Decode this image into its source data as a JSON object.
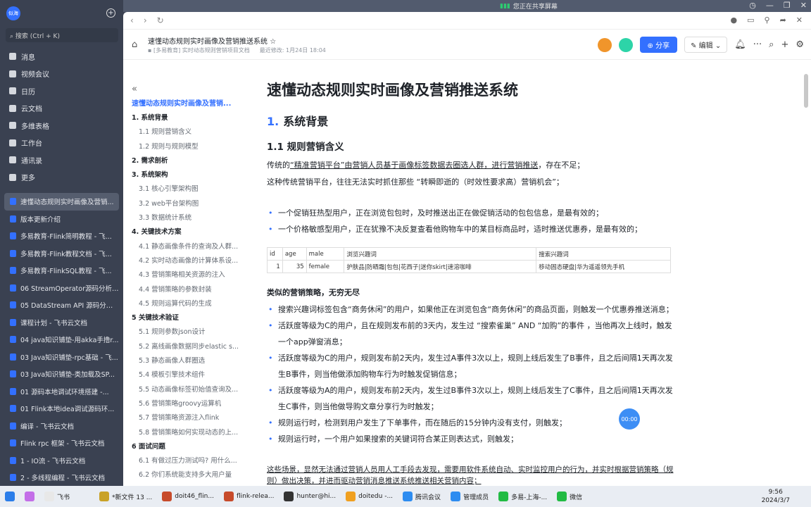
{
  "topbar": {
    "sharing_text": "您正在共享屏幕"
  },
  "sidebar": {
    "avatar": "似海",
    "search_placeholder": "搜索 (Ctrl + K)",
    "nav": [
      "消息",
      "视频会议",
      "日历",
      "云文档",
      "多维表格",
      "工作台",
      "通讯录",
      "更多"
    ],
    "docs": [
      "速懂动态规则实时画像及营销...",
      "版本更新介绍",
      "多易教育-Flink简明教程 - 飞...",
      "多易教育-Flink教程文档 - 飞...",
      "多易教育-FlinkSQL教程 - 飞...",
      "06 StreamOperator源码分析 -...",
      "05 DataStream API 源码分析...",
      "课程计划 - 飞书云文档",
      "04 java知识铺垫-用akka手撸r...",
      "03 Java知识铺垫-rpc基础 - 飞...",
      "03 Java知识铺垫-类加载及SP...",
      "01 源码本地调试环境搭建 -...",
      "01 Flink本地idea调试源码环...",
      "编译 - 飞书云文档",
      "Flink rpc 框架 - 飞书云文档",
      "1 - IO流 - 飞书云文档",
      "2 - 多线程编程 - 飞书云文档"
    ]
  },
  "header": {
    "title": "速懂动态规则实时画像及营销推送系统",
    "folder": "[多易教育] 实时动态规则营销项目文档",
    "modified": "最近修改: 1月24日 18:04",
    "share": "分享",
    "edit": "编辑"
  },
  "toc": {
    "title": "速懂动态规则实时画像及营销...",
    "items": [
      {
        "l": 1,
        "t": "1. 系统背景"
      },
      {
        "l": 2,
        "t": "1.1 规则营销含义"
      },
      {
        "l": 2,
        "t": "1.2 规则与规则模型"
      },
      {
        "l": 1,
        "t": "2. 需求剖析"
      },
      {
        "l": 1,
        "t": "3. 系统架构"
      },
      {
        "l": 2,
        "t": "3.1 核心引擎架构图"
      },
      {
        "l": 2,
        "t": "3.2 web平台架构图"
      },
      {
        "l": 2,
        "t": "3.3 数据统计系统"
      },
      {
        "l": 1,
        "t": "4. 关键技术方案"
      },
      {
        "l": 2,
        "t": "4.1 静态画像条件的查询及人群..."
      },
      {
        "l": 2,
        "t": "4.2 实时动态画像的计算体系设..."
      },
      {
        "l": 2,
        "t": "4.3 营销策略相关资源的注入"
      },
      {
        "l": 2,
        "t": "4.4 营销策略的参数封装"
      },
      {
        "l": 2,
        "t": "4.5 规则运算代码的生成"
      },
      {
        "l": 1,
        "t": "5 关键技术验证"
      },
      {
        "l": 2,
        "t": "5.1 规则参数json设计"
      },
      {
        "l": 2,
        "t": "5.2 离线画像数据同步elastic s..."
      },
      {
        "l": 2,
        "t": "5.3 静态画像人群圈选"
      },
      {
        "l": 2,
        "t": "5.4 模板引擎技术组件"
      },
      {
        "l": 2,
        "t": "5.5 动态画像标签初始值查询及..."
      },
      {
        "l": 2,
        "t": "5.6 营销策略groovy运算机"
      },
      {
        "l": 2,
        "t": "5.7 营销策略资源注入flink"
      },
      {
        "l": 2,
        "t": "5.8 营销策略如何实现动态的上..."
      },
      {
        "l": 1,
        "t": "6 面试问题"
      },
      {
        "l": 2,
        "t": "6.1 有做过压力测试吗? 用什么..."
      },
      {
        "l": 2,
        "t": "6.2 你们系统能支持多大用户量"
      }
    ]
  },
  "doc": {
    "h1": "速懂动态规则实时画像及营销推送系统",
    "h2_num": "1.",
    "h2": "系统背景",
    "h3": "1.1 规则营销含义",
    "p1a": "传统的",
    "p1b": "“精准营销平台”由营销人员基于画像标签数据去圈选人群，进行营销推送",
    "p1c": "，存在不足；",
    "p2": "这种传统营销平台，往往无法实时抓住那些 “转瞬即逝的（时效性要求高）营销机会”；",
    "bullets1": [
      "一个促销狂热型用户，正在浏览包包时，及时推送出正在做促销活动的包包信息，是最有效的；",
      "一个价格敏感型用户，正在犹豫不决反复查看他购物车中的某目标商品时，适时推送优惠券，是最有效的；"
    ],
    "table": {
      "headers": [
        "id",
        "age",
        "male",
        "浏览兴趣词",
        "搜索兴趣词"
      ],
      "rows": [
        [
          "1",
          "35",
          "female",
          "护肤品|防晒霜|包包|花西子|迷你skirt|速溶咖啡",
          "移动固态硬盘|华为遥遥领先手机"
        ]
      ]
    },
    "bold": "类似的营销策略，无穷无尽",
    "bullets2": [
      "搜索兴趣词标签包含“商务休闲”的用户，如果他正在浏览包含“商务休闲”的商品页面，则触发一个优惠券推送消息；",
      "活跃度等级为C的用户，且在规则发布前的3天内，发生过 “搜索雀巢” AND “加购”的事件 ，当他再次上线时，触发一个app弹窗消息；",
      "活跃度等级为C的用户，规则发布前2天内，发生过A事件3次以上，规则上线后发生了B事件，且之后间隔1天再次发生B事件，则当他做添加购物车行为时触发促销信息；",
      "活跃度等级为A的用户，规则发布前2天内，发生过B事件3次以上，规则上线后发生了C事件，且之后间隔1天再次发生C事件，则当他做导购文章分享行为时触发；",
      "规则运行时，检测到用户发生了下单事件，而在随后的15分钟内没有支付，则触发；",
      "规则运行时，一个用户如果搜索的关键词符合某正则表达式，则触发；"
    ],
    "p3": "这些场景，显然无法通过营销人员用人工手段去发现，需要用软件系统自动、实时监控用户的行为，并实时根据营销策略（规则）做出决策，并进而驱动营销消息推送系统推送相关营销内容；"
  },
  "timer": "00:00",
  "taskbar": {
    "apps": [
      "飞书",
      "*新文件 13 ...",
      "doit46_flin...",
      "flink-relea...",
      "hunter@hi...",
      "doitedu -...",
      "腾讯会议",
      "管理成员",
      "多易-上海-...",
      "微信"
    ],
    "time": "9:56",
    "date": "2024/3/7"
  }
}
